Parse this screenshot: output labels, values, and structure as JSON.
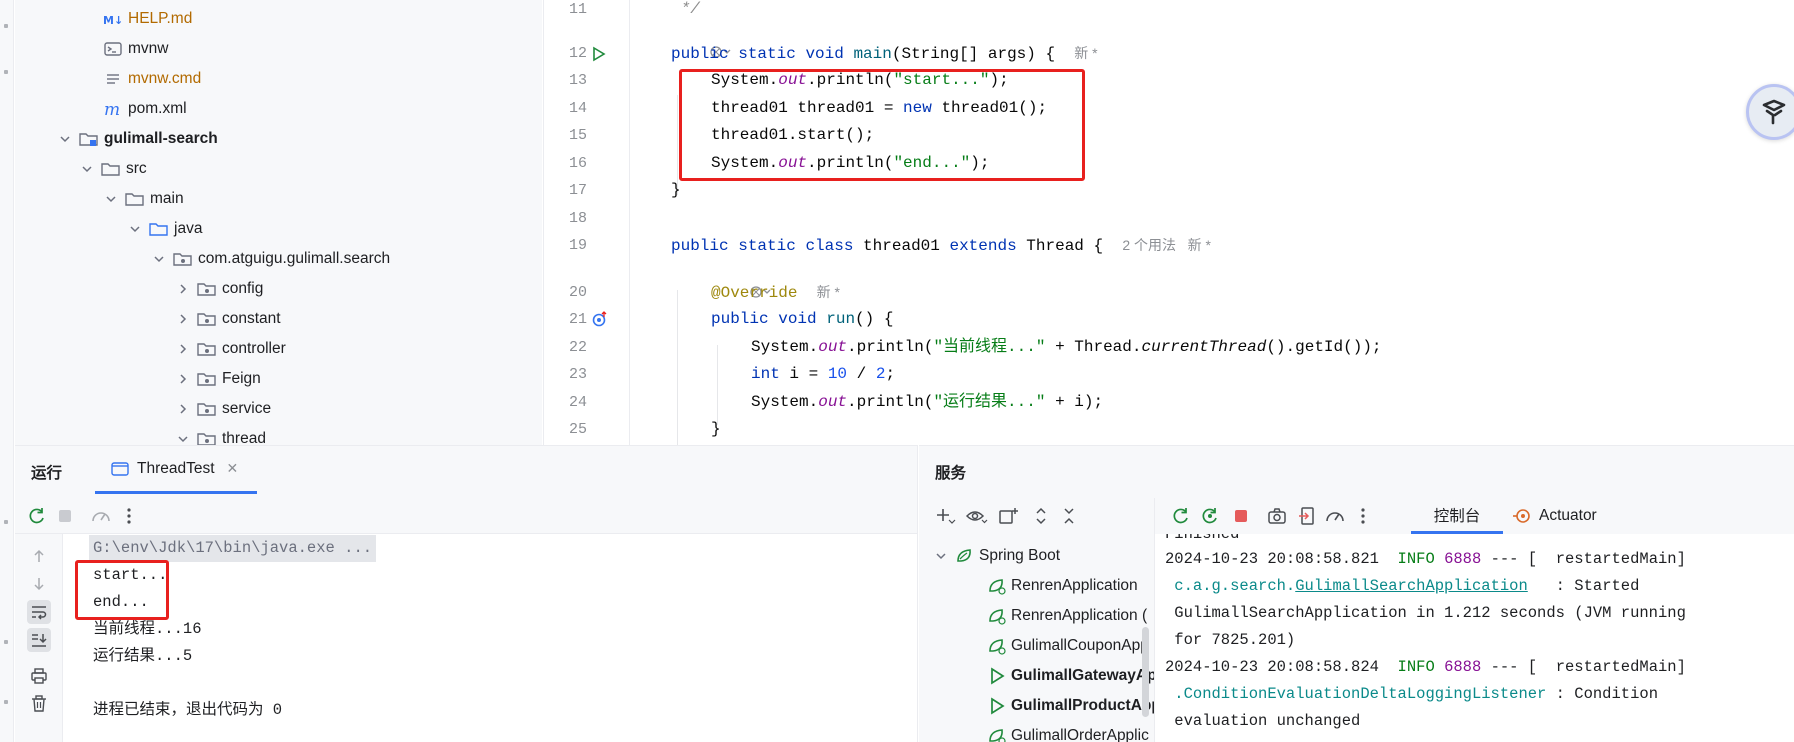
{
  "project_tree": {
    "items": [
      {
        "label": "HELP.md",
        "icon": "markdown-icon",
        "style": "orange"
      },
      {
        "label": "mvnw",
        "icon": "terminal-file-icon",
        "style": "normal"
      },
      {
        "label": "mvnw.cmd",
        "icon": "text-file-icon",
        "style": "orange"
      },
      {
        "label": "pom.xml",
        "icon": "maven-icon",
        "style": "normal"
      },
      {
        "label": "gulimall-search",
        "icon": "module-folder-icon",
        "style": "bold"
      },
      {
        "label": "src",
        "icon": "folder-icon",
        "style": "normal"
      },
      {
        "label": "main",
        "icon": "folder-icon",
        "style": "normal"
      },
      {
        "label": "java",
        "icon": "source-folder-icon",
        "style": "normal"
      },
      {
        "label": "com.atguigu.gulimall.search",
        "icon": "package-icon",
        "style": "normal"
      },
      {
        "label": "config",
        "icon": "package-icon",
        "style": "normal"
      },
      {
        "label": "constant",
        "icon": "package-icon",
        "style": "normal"
      },
      {
        "label": "controller",
        "icon": "package-icon",
        "style": "normal"
      },
      {
        "label": "Feign",
        "icon": "package-icon",
        "style": "normal"
      },
      {
        "label": "service",
        "icon": "package-icon",
        "style": "normal"
      },
      {
        "label": "thread",
        "icon": "package-icon",
        "style": "normal"
      }
    ]
  },
  "editor": {
    "line_numbers": [
      "11",
      "12",
      "13",
      "14",
      "15",
      "16",
      "17",
      "18",
      "19",
      "20",
      "21",
      "22",
      "23",
      "24",
      "25"
    ],
    "code": {
      "l11": " */",
      "l12_public": "public",
      "l12_static": "static",
      "l12_void": "void",
      "l12_main": "main",
      "l12_rest": "(String[] args) {",
      "l12_hint": "新 *",
      "l13_a": "System.",
      "l13_out": "out",
      "l13_b": ".println(",
      "l13_str": "\"start...\"",
      "l13_c": ");",
      "l14_a": "thread01 thread01 = ",
      "l14_new": "new",
      "l14_b": " thread01();",
      "l15": "thread01.start();",
      "l16_a": "System.",
      "l16_out": "out",
      "l16_b": ".println(",
      "l16_str": "\"end...\"",
      "l16_c": ");",
      "l17": "}",
      "l19_public": "public",
      "l19_static": "static",
      "l19_class": "class",
      "l19_name": " thread01 ",
      "l19_extends": "extends",
      "l19_rest": " Thread {",
      "l19_hint": "2 个用法   新 *",
      "l20_ann": "@Override",
      "l20_hint": "新 *",
      "l21_public": "public",
      "l21_void": "void",
      "l21_run": "run",
      "l21_rest": "() {",
      "l22_a": "System.",
      "l22_out": "out",
      "l22_b": ".println(",
      "l22_str": "\"当前线程...\"",
      "l22_c": " + Thread.",
      "l22_ct": "currentThread",
      "l22_d": "().getId());",
      "l23_int": "int",
      "l23_a": " i = ",
      "l23_n1": "10",
      "l23_b": " / ",
      "l23_n2": "2",
      "l23_c": ";",
      "l24_a": "System.",
      "l24_out": "out",
      "l24_b": ".println(",
      "l24_str": "\"运行结果...\"",
      "l24_c": " + i);",
      "l25": "}"
    }
  },
  "run_panel": {
    "title": "运行",
    "tab_label": "ThreadTest",
    "console_lines": {
      "cmd": "G:\\env\\Jdk\\17\\bin\\java.exe ...",
      "start": "start...",
      "end": "end...",
      "thread": "当前线程...16",
      "result": "运行结果...5",
      "exit": "进程已结束，退出代码为 0"
    }
  },
  "services_panel": {
    "title": "服务",
    "tabs": {
      "console": "控制台",
      "actuator": "Actuator"
    },
    "tree": [
      {
        "label": "Spring Boot",
        "icon": "spring-boot-icon",
        "bold": false
      },
      {
        "label": "RenrenApplication",
        "icon": "spring-app-icon",
        "bold": false
      },
      {
        "label": "RenrenApplication (",
        "icon": "spring-app-icon",
        "bold": false
      },
      {
        "label": "GulimallCouponApp",
        "icon": "spring-app-icon",
        "bold": false
      },
      {
        "label": "GulimallGatewayAp",
        "icon": "run-app-icon",
        "bold": true
      },
      {
        "label": "GulimallProductApp",
        "icon": "run-app-icon",
        "bold": true
      },
      {
        "label": "GulimallOrderApplic",
        "icon": "spring-app-icon",
        "bold": false
      }
    ],
    "log": {
      "l0": "Finished",
      "l1_ts": "2024-10-23 20:08:58.821  ",
      "l1_level": "INFO",
      "l1_pid": " 6888",
      "l1_rest": " --- [  restartedMain]",
      "l2_pkg": " c.a.g.search.",
      "l2_cls": "GulimallSearchApplication",
      "l2_rest": "   : Started",
      "l3": " GulimallSearchApplication in 1.212 seconds (JVM running",
      "l4": " for 7825.201)",
      "l5_ts": "2024-10-23 20:08:58.824  ",
      "l5_level": "INFO",
      "l5_pid": " 6888",
      "l5_rest": " --- [  restartedMain]",
      "l6_cls": " .ConditionEvaluationDeltaLoggingListener",
      "l6_rest": " : Condition",
      "l7": " evaluation unchanged"
    }
  },
  "colors": {
    "accent": "#3574f0",
    "highlight_box": "#e8201e",
    "keyword": "#0033b3",
    "string": "#067d17"
  }
}
